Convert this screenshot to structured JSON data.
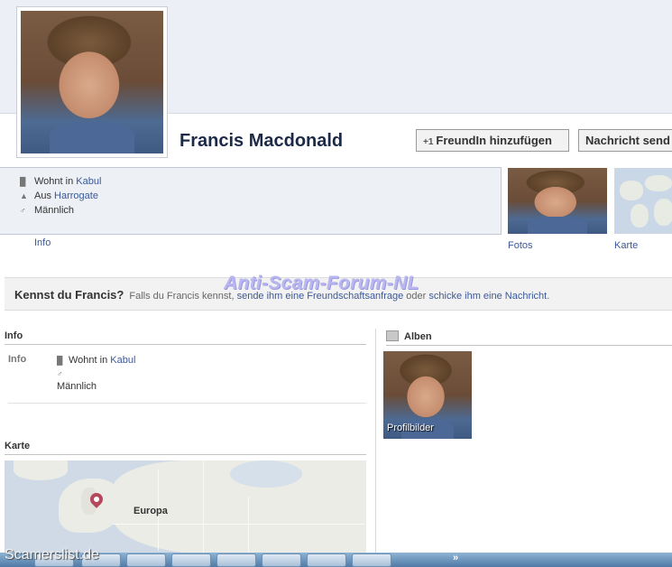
{
  "profile": {
    "name": "Francis Macdonald",
    "add_friend_label": "FreundIn hinzufügen",
    "message_label": "Nachricht send"
  },
  "intro": {
    "lives_prefix": "Wohnt in ",
    "lives_city": "Kabul",
    "from_prefix": "Aus ",
    "from_city": "Harrogate",
    "gender": "Männlich",
    "info_tab": "Info"
  },
  "thumbs": {
    "fotos": "Fotos",
    "karte": "Karte"
  },
  "watermark": "Anti-Scam-Forum-NL",
  "kennst": {
    "title": "Kennst du Francis?",
    "desc_prefix": "Falls du Francis kennst, ",
    "desc_link1": "sende ihm eine Freundschaftsanfrage",
    "desc_mid": " oder ",
    "desc_link2": "schicke ihm eine Nachricht",
    "desc_suffix": "."
  },
  "info_section": {
    "heading": "Info",
    "key": "Info",
    "lives_prefix": "Wohnt in ",
    "lives_city": "Kabul",
    "gender": "Männlich"
  },
  "karte_section": {
    "heading": "Karte",
    "region_label": "Europa"
  },
  "alben_section": {
    "heading": "Alben",
    "album_caption": "Profilbilder"
  },
  "footer_watermark": "Scamerslist.de",
  "taskbar": {
    "chevron": "»"
  },
  "colors": {
    "link": "#3b5998",
    "name": "#1c2a47",
    "watermark": "#b9b7ee",
    "pin": "#b5485d"
  },
  "icons": [
    "home-work-icon",
    "home-icon",
    "male-icon",
    "add-friend-icon",
    "album-icon",
    "map-pin-icon"
  ]
}
